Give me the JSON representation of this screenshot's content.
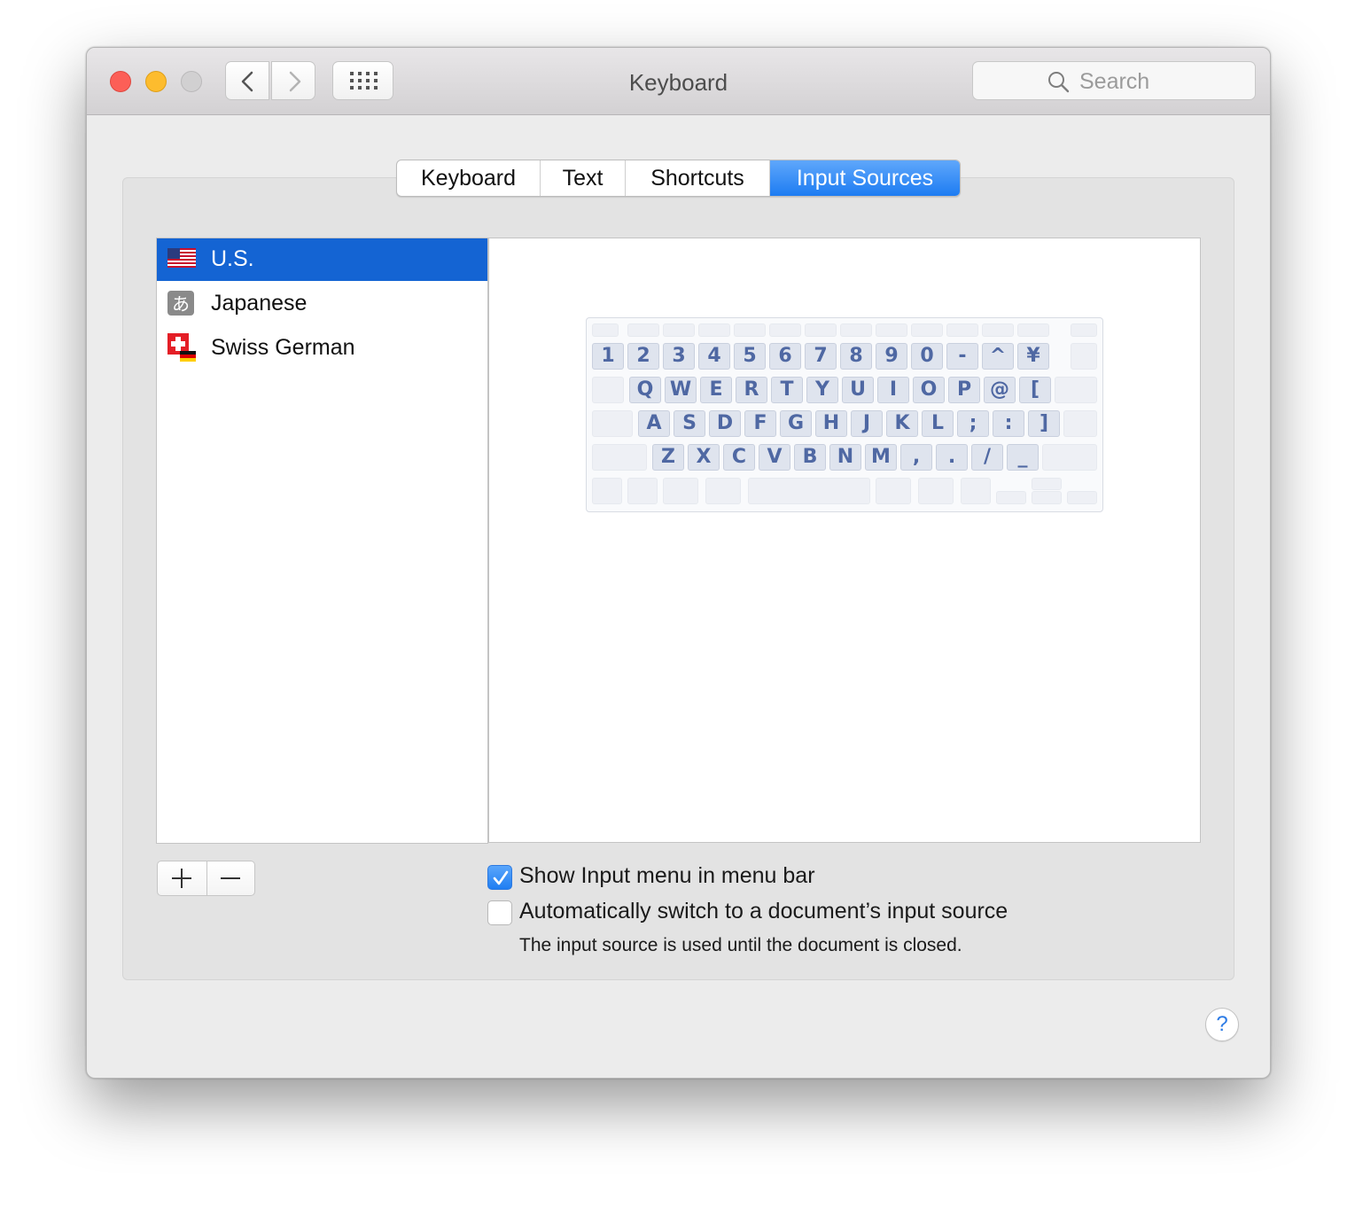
{
  "window": {
    "title": "Keyboard"
  },
  "toolbar": {
    "search_placeholder": "Search"
  },
  "tabs": [
    {
      "label": "Keyboard",
      "active": false
    },
    {
      "label": "Text",
      "active": false
    },
    {
      "label": "Shortcuts",
      "active": false
    },
    {
      "label": "Input Sources",
      "active": true
    }
  ],
  "input_sources": [
    {
      "label": "U.S.",
      "icon": "us-flag-icon",
      "selected": true
    },
    {
      "label": "Japanese",
      "icon": "hiragana-a-icon",
      "selected": false
    },
    {
      "label": "Swiss German",
      "icon": "swiss-german-flag-icon",
      "selected": false
    }
  ],
  "japanese_icon_glyph": "あ",
  "keyboard_preview": {
    "row1": [
      "1",
      "2",
      "3",
      "4",
      "5",
      "6",
      "7",
      "8",
      "9",
      "0",
      "-",
      "^",
      "¥"
    ],
    "row2": [
      "Q",
      "W",
      "E",
      "R",
      "T",
      "Y",
      "U",
      "I",
      "O",
      "P",
      "@",
      "["
    ],
    "row3": [
      "A",
      "S",
      "D",
      "F",
      "G",
      "H",
      "J",
      "K",
      "L",
      ";",
      ":",
      "]"
    ],
    "row4": [
      "Z",
      "X",
      "C",
      "V",
      "B",
      "N",
      "M",
      ",",
      ".",
      "/",
      "_"
    ]
  },
  "list_buttons": {
    "add": "+",
    "remove": "—"
  },
  "options": {
    "show_input_menu": {
      "label": "Show Input menu in menu bar",
      "checked": true
    },
    "auto_switch": {
      "label": "Automatically switch to a document’s input source",
      "checked": false
    },
    "auto_switch_note": "The input source is used until the document is closed."
  },
  "help_label": "?",
  "colors": {
    "accent": "#1d7cf2",
    "selection": "#1464d3",
    "key_text": "#4f68a3"
  }
}
